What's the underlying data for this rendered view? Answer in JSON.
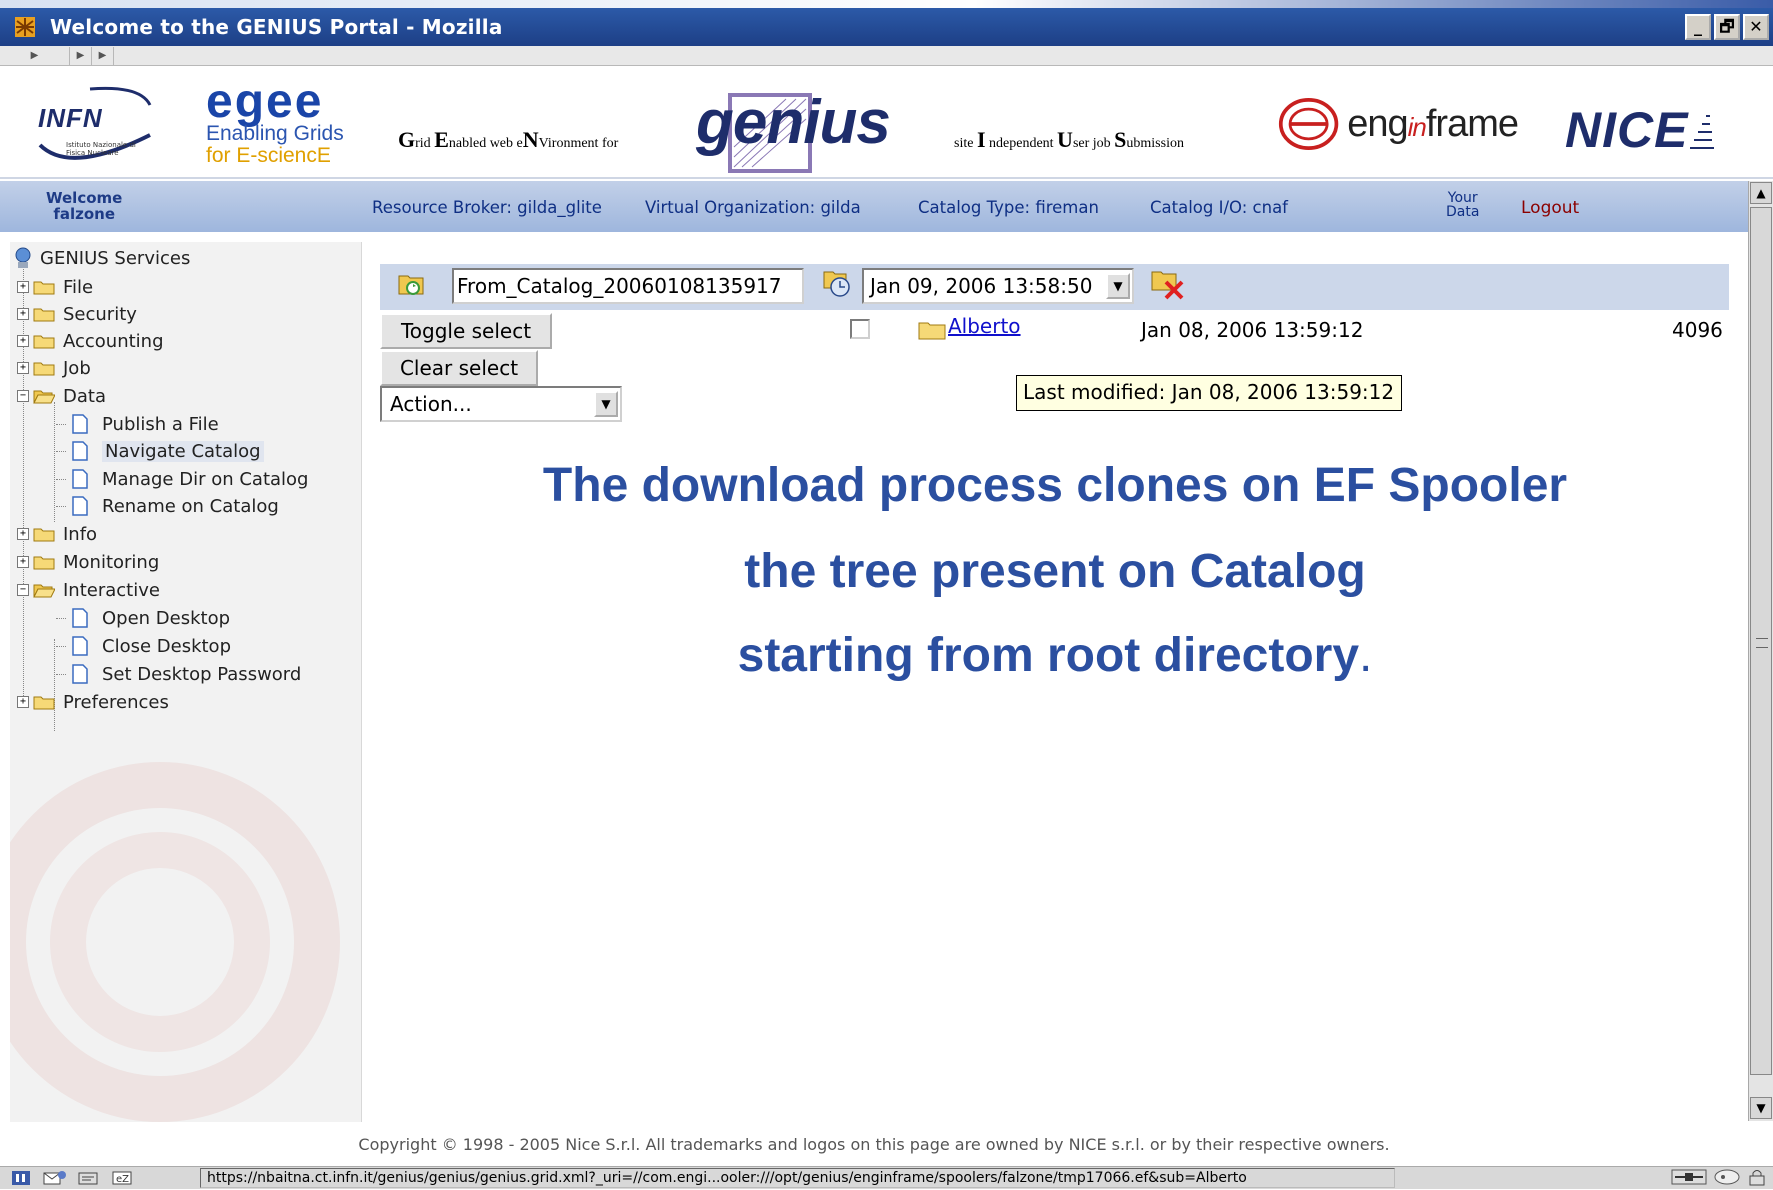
{
  "window": {
    "title": "Welcome to the GENIUS Portal - Mozilla",
    "buttons": [
      "_",
      "🗗",
      "✕"
    ]
  },
  "logos": {
    "infn": {
      "word": "INFN",
      "sub": "Istituto Nazionale di Fisica Nucleare"
    },
    "egee": {
      "word": "egee",
      "line1": "Enabling Grids",
      "line2": "for E-sciencE"
    },
    "grid_tagline": {
      "G": "G",
      "g_rest": "rid ",
      "E": "E",
      "e_rest": "nabled web e",
      "N": "N",
      "n_rest": "Vironment for"
    },
    "genius": "genius",
    "site_tagline": {
      "pre": "site ",
      "I": "I",
      "i_rest": " ndependent ",
      "U": "U",
      "u_rest": "ser job ",
      "S": "S",
      "s_rest": "ubmission"
    },
    "enginframe": {
      "pre": "eng",
      "mid": "in",
      "post": "frame"
    },
    "nice": "NICE"
  },
  "infobar": {
    "welcome_line1": "Welcome",
    "welcome_line2": "falzone",
    "resource_broker": "Resource Broker: gilda_glite",
    "virtual_org": "Virtual Organization: gilda",
    "catalog_type": "Catalog Type: fireman",
    "catalog_io": "Catalog I/O: cnaf",
    "your_data_line1": "Your",
    "your_data_line2": "Data",
    "logout": "Logout"
  },
  "sidebar": {
    "root": "GENIUS Services",
    "items": [
      {
        "label": "File",
        "state": "collapsed"
      },
      {
        "label": "Security",
        "state": "collapsed"
      },
      {
        "label": "Accounting",
        "state": "collapsed"
      },
      {
        "label": "Job",
        "state": "collapsed"
      },
      {
        "label": "Data",
        "state": "expanded",
        "children": [
          "Publish a File",
          "Navigate Catalog",
          "Manage Dir on Catalog",
          "Rename on Catalog"
        ]
      },
      {
        "label": "Info",
        "state": "collapsed"
      },
      {
        "label": "Monitoring",
        "state": "collapsed"
      },
      {
        "label": "Interactive",
        "state": "expanded",
        "children": [
          "Open Desktop",
          "Close Desktop",
          "Set Desktop Password"
        ]
      },
      {
        "label": "Preferences",
        "state": "collapsed"
      }
    ],
    "selected": "Navigate Catalog"
  },
  "main": {
    "dir_value": "From_Catalog_20060108135917",
    "date_selected": "Jan 09, 2006 13:58:50",
    "toggle_select": "Toggle select",
    "clear_select": "Clear select",
    "action_selected": "Action...",
    "row": {
      "name": "Alberto",
      "date": "Jan 08, 2006 13:59:12",
      "size": "4096",
      "checked": false
    },
    "tooltip": "Last modified: Jan 08, 2006 13:59:12",
    "overlay_line1": "The download process clones on EF Spooler",
    "overlay_line2": "the tree present on Catalog",
    "overlay_line3": "starting from root directory",
    "overlay_line3_end": "."
  },
  "footer": {
    "copyright": "Copyright © 1998 - 2005 Nice S.r.l. All trademarks and logos on this page are owned by NICE s.r.l. or by their respective owners."
  },
  "statusbar": {
    "url": "https://nbaitna.ct.infn.it/genius/genius/genius.grid.xml?_uri=//com.engi...ooler:///opt/genius/enginframe/spoolers/falzone/tmp17066.ef&sub=Alberto"
  },
  "colors": {
    "titlebar": "#1d3f86",
    "infobar": "#b2c4e3",
    "link": "#1010cc",
    "overlay_text": "#2b4fa0",
    "logout": "#8b0000"
  }
}
